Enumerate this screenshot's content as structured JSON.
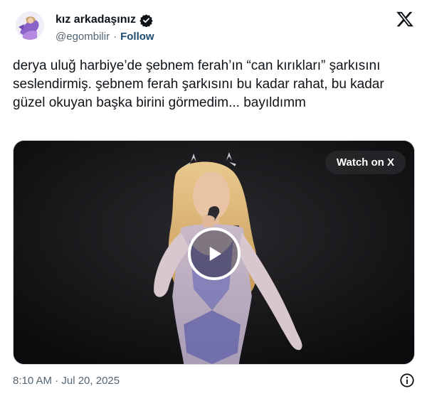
{
  "author": {
    "display_name": "kız arkadaşınız",
    "handle": "@egombilir",
    "separator": "·",
    "follow_label": "Follow",
    "avatar_icon": "avatar-illustration-icon",
    "verified_icon": "verified-badge-icon"
  },
  "platform": {
    "logo_icon": "x-logo-icon"
  },
  "tweet": {
    "text": "derya uluğ harbiye’de şebnem ferah’ın “can kırıkları” şarkısını seslendirmiş. şebnem ferah şarkısını bu kadar rahat, bu kadar güzel okuyan başka birini görmedim... bayıldımm"
  },
  "media": {
    "watch_label": "Watch on X",
    "play_icon": "play-icon"
  },
  "footer": {
    "timestamp": "8:10 AM · Jul 20, 2025",
    "info_icon": "info-icon"
  },
  "colors": {
    "text_primary": "#0f1419",
    "text_secondary": "#536471",
    "follow": "#1d4b70",
    "verified_badge": "#0f1419",
    "media_background": "#0e0e10"
  }
}
